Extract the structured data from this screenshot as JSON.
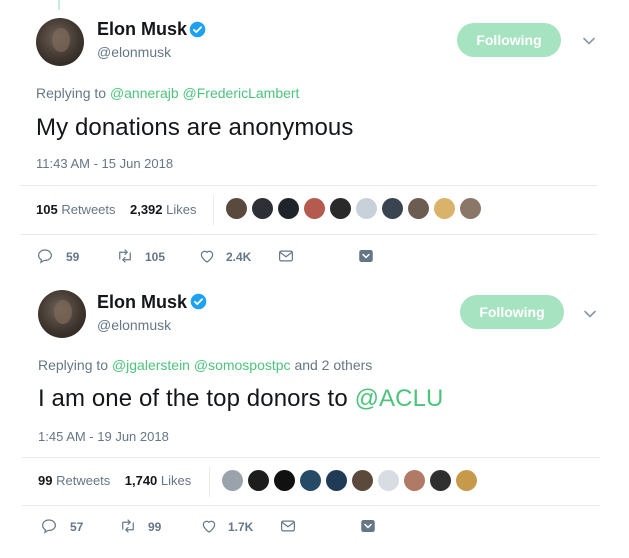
{
  "tweets": [
    {
      "name": "Elon Musk",
      "handle": "@elonmusk",
      "follow_label": "Following",
      "reply_prefix": "Replying to",
      "reply_mentions": "@annerajb @FredericLambert",
      "reply_suffix": "",
      "text": "My donations are anonymous",
      "text_link": "",
      "timestamp": "11:43 AM - 15 Jun 2018",
      "retweets": "105",
      "retweets_label": "Retweets",
      "likes": "2,392",
      "likes_label": "Likes",
      "actions": {
        "replies": "59",
        "retweets": "105",
        "likes": "2.4K"
      }
    },
    {
      "name": "Elon Musk",
      "handle": "@elonmusk",
      "follow_label": "Following",
      "reply_prefix": "Replying to",
      "reply_mentions": "@jgalerstein @somospostpc",
      "reply_suffix": "and 2 others",
      "text": "I am one of the top donors to",
      "text_link": "@ACLU",
      "timestamp": "1:45 AM - 19 Jun 2018",
      "retweets": "99",
      "retweets_label": "Retweets",
      "likes": "1,740",
      "likes_label": "Likes",
      "actions": {
        "replies": "57",
        "retweets": "99",
        "likes": "1.7K"
      }
    }
  ],
  "colors": {
    "accent": "#4cc47c",
    "follow_bg": "#a6e3c0",
    "muted": "#657786",
    "verified": "#1da1f2"
  },
  "icons": [
    "verified-badge-icon",
    "chevron-down-icon",
    "reply-icon",
    "retweet-icon",
    "like-icon",
    "message-icon",
    "more-icon"
  ]
}
